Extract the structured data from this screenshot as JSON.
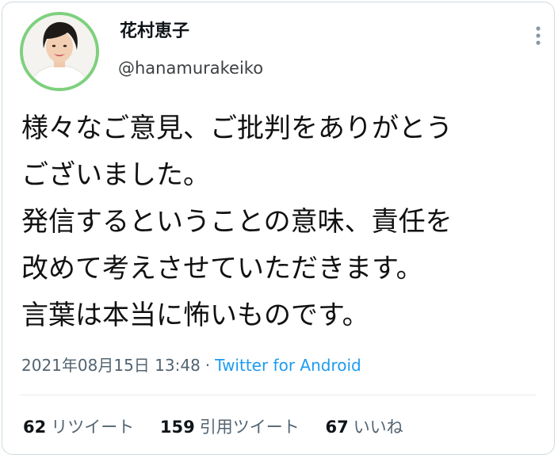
{
  "author": {
    "display_name": "花村恵子",
    "handle": "@hanamurakeiko",
    "avatar_ring_color": "#7ed07e"
  },
  "tweet": {
    "lines": [
      "様々なご意見、ご批判をありがとう",
      "ございました。",
      "発信するということの意味、責任を",
      "改めて考えさせていただきます。",
      "言葉は本当に怖いものです。"
    ],
    "timestamp": "2021年08月15日 13:48",
    "separator": "·",
    "source": "Twitter for Android"
  },
  "stats": {
    "retweets": {
      "count": "62",
      "label": "リツイート"
    },
    "quotes": {
      "count": "159",
      "label": "引用ツイート"
    },
    "likes": {
      "count": "67",
      "label": "いいね"
    }
  },
  "colors": {
    "link": "#1d9bf0",
    "muted": "#536471",
    "border": "#cfd9de"
  },
  "icons": {
    "more": "vertical-ellipsis-icon"
  }
}
